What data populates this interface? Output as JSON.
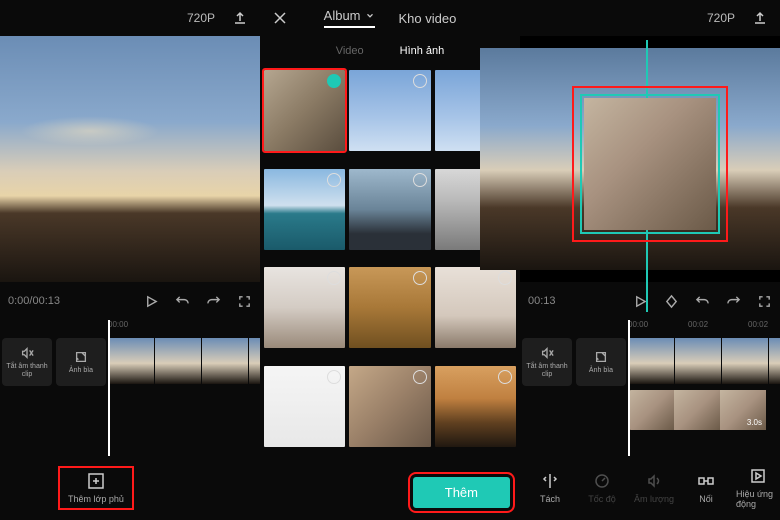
{
  "left": {
    "resolution": "720P",
    "time": "0:00/00:13",
    "ticks": [
      "00:00"
    ],
    "tool_mute": "Tắt âm thanh clip",
    "tool_cover": "Ảnh bìa",
    "add_overlay": "Thêm lớp phủ"
  },
  "picker": {
    "album": "Album",
    "stock": "Kho video",
    "tab_video": "Video",
    "tab_image": "Hình ảnh",
    "add": "Thêm"
  },
  "right": {
    "resolution": "720P",
    "time": "00:13",
    "ticks": [
      "00:00",
      "00:02",
      "00:02"
    ],
    "tool_mute": "Tắt âm thanh clip",
    "tool_cover": "Ảnh bìa",
    "overlay_duration": "3.0s",
    "actions": {
      "split": "Tách",
      "speed": "Tốc độ",
      "volume": "Âm lượng",
      "splice": "Nối",
      "fx": "Hiệu ứng động"
    }
  }
}
